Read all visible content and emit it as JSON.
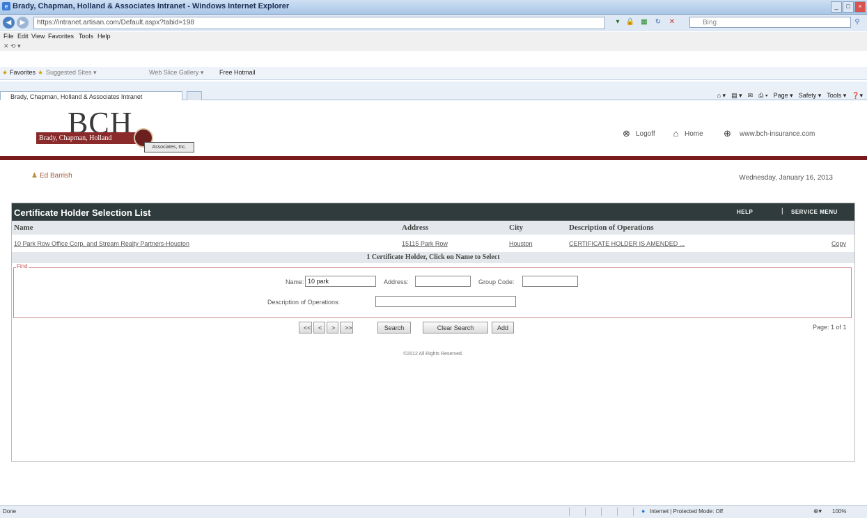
{
  "window": {
    "title": "Brady, Chapman, Holland & Associates Intranet - Windows Internet Explorer",
    "controls": [
      "_",
      "□",
      "×"
    ]
  },
  "addressbar": {
    "url": "https://intranet.artisan.com/Default.aspx?tabid=198",
    "search_placeholder": "Bing"
  },
  "menubar": {
    "items": [
      "File",
      "Edit",
      "View",
      "Favorites",
      "Tools",
      "Help"
    ]
  },
  "favorites": {
    "label": "Favorites",
    "items": [
      "Suggested Sites ▾",
      "Web Slice Gallery ▾",
      "Free Hotmail"
    ]
  },
  "tab": {
    "label": "Brady, Chapman, Holland & Associates Intranet"
  },
  "commandbar": {
    "items": [
      "Page ▾",
      "Safety ▾",
      "Tools ▾"
    ]
  },
  "header": {
    "logo_text": "BCH",
    "logo_band": "Brady, Chapman, Holland",
    "logo_assoc": "Associates, Inc.",
    "logoff": "Logoff",
    "home": "Home",
    "website": "www.bch-insurance.com",
    "user": "Ed Barrish",
    "date": "Wednesday, January 16, 2013"
  },
  "panel": {
    "title": "Certificate Holder Selection List",
    "help": "HELP",
    "separator": "|",
    "service_menu": "SERVICE MENU",
    "columns": [
      "Name",
      "Address",
      "City",
      "Description of Operations"
    ],
    "rows": [
      {
        "name": "10 Park Row Office Corp. and Stream Realty Partners-Houston",
        "address": "15115 Park Row",
        "city": "Houston",
        "description": "CERTIFICATE HOLDER IS AMENDED ...",
        "action": "Copy"
      }
    ],
    "count_text": "1 Certificate Holder, Click on Name to Select"
  },
  "find": {
    "legend": "Find",
    "name_label": "Name:",
    "name_value": "10 park",
    "address_label": "Address:",
    "address_value": "",
    "group_code_label": "Group Code:",
    "group_code_value": "",
    "description_label": "Description of Operations:",
    "description_value": ""
  },
  "pager": {
    "first": "<<",
    "prev": "<",
    "next": ">",
    "last": ">>",
    "search": "Search",
    "clear": "Clear Search",
    "add": "Add",
    "page_info": "Page: 1 of 1"
  },
  "footer": {
    "copyright": "©2012 All Rights Reserved."
  },
  "statusbar": {
    "left": "Done",
    "zone": "Internet | Protected Mode: Off",
    "zoom": "100%"
  }
}
